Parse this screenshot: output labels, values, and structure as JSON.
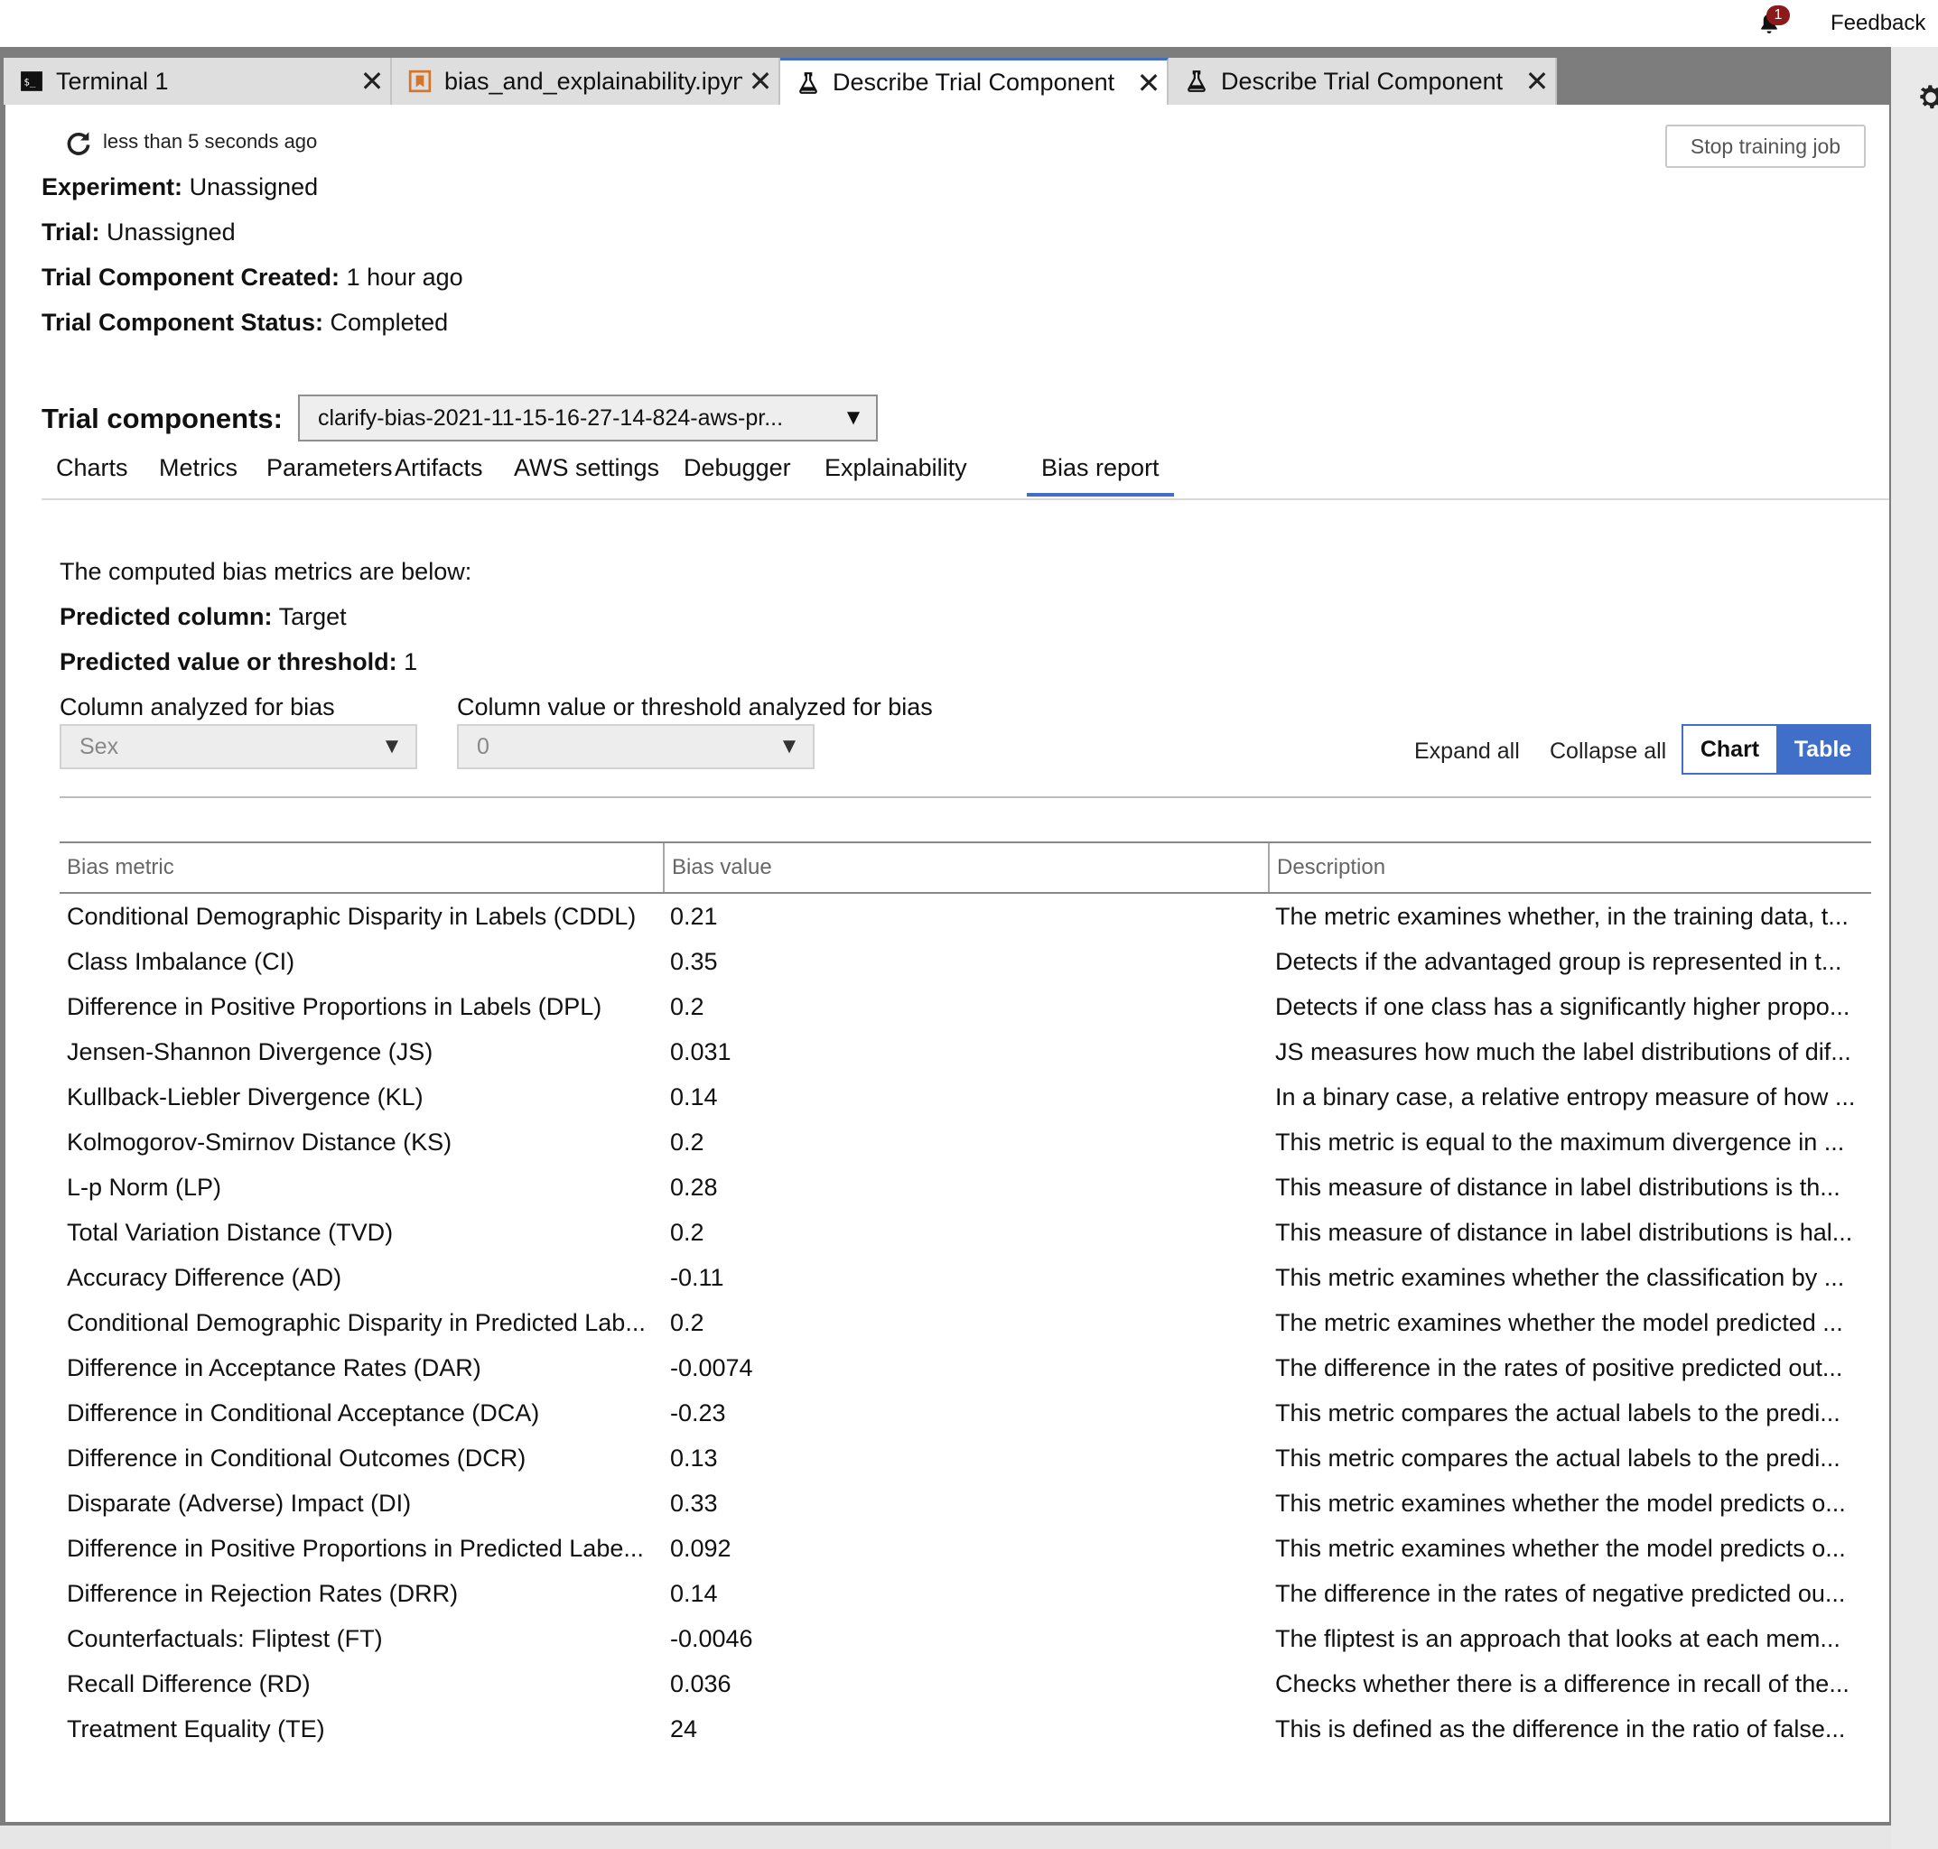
{
  "topbar": {
    "notification_count": "1",
    "feedback_label": "Feedback"
  },
  "tabs": [
    {
      "label": "Terminal 1",
      "icon": "terminal-icon",
      "active": false
    },
    {
      "label": "bias_and_explainability.ipynb",
      "icon": "notebook-icon",
      "active": false
    },
    {
      "label": "Describe Trial Component",
      "icon": "flask-icon",
      "active": true
    },
    {
      "label": "Describe Trial Component",
      "icon": "flask-icon",
      "active": false
    }
  ],
  "header": {
    "last_updated": "less than 5 seconds ago",
    "stop_button": "Stop training job"
  },
  "info": {
    "experiment_label": "Experiment:",
    "experiment_value": "Unassigned",
    "trial_label": "Trial:",
    "trial_value": "Unassigned",
    "created_label": "Trial Component Created:",
    "created_value": "1 hour ago",
    "status_label": "Trial Component Status:",
    "status_value": "Completed"
  },
  "trial_components": {
    "label": "Trial components:",
    "selected": "clarify-bias-2021-11-15-16-27-14-824-aws-pr..."
  },
  "subtabs": [
    "Charts",
    "Metrics",
    "Parameters",
    "Artifacts",
    "AWS settings",
    "Debugger",
    "Explainability",
    "Bias report"
  ],
  "bias_report": {
    "intro": "The computed bias metrics are below:",
    "predicted_column_label": "Predicted column:",
    "predicted_column_value": "Target",
    "predicted_value_label": "Predicted value or threshold:",
    "predicted_value_value": "1",
    "column_label": "Column analyzed for bias",
    "column_value": "Sex",
    "column_value_label": "Column value or threshold analyzed for bias",
    "column_value_value": "0",
    "expand_all": "Expand all",
    "collapse_all": "Collapse all",
    "toggle_chart": "Chart",
    "toggle_table": "Table"
  },
  "table": {
    "headers": [
      "Bias metric",
      "Bias value",
      "Description"
    ],
    "rows": [
      [
        "Conditional Demographic Disparity in Labels (CDDL)",
        "0.21",
        "The metric examines whether, in the training data, t..."
      ],
      [
        "Class Imbalance (CI)",
        "0.35",
        "Detects if the advantaged group is represented in t..."
      ],
      [
        "Difference in Positive Proportions in Labels (DPL)",
        "0.2",
        "Detects if one class has a significantly higher propo..."
      ],
      [
        "Jensen-Shannon Divergence (JS)",
        "0.031",
        "JS measures how much the label distributions of dif..."
      ],
      [
        "Kullback-Liebler Divergence (KL)",
        "0.14",
        "In a binary case, a relative entropy measure of how ..."
      ],
      [
        "Kolmogorov-Smirnov Distance (KS)",
        "0.2",
        "This metric is equal to the maximum divergence in ..."
      ],
      [
        "L-p Norm (LP)",
        "0.28",
        "This measure of distance in label distributions is th..."
      ],
      [
        "Total Variation Distance (TVD)",
        "0.2",
        "This measure of distance in label distributions is hal..."
      ],
      [
        "Accuracy Difference (AD)",
        "-0.11",
        "This metric examines whether the classification by ..."
      ],
      [
        "Conditional Demographic Disparity in Predicted Lab...",
        "0.2",
        "The metric examines whether the model predicted ..."
      ],
      [
        "Difference in Acceptance Rates (DAR)",
        "-0.0074",
        "The difference in the rates of positive predicted out..."
      ],
      [
        "Difference in Conditional Acceptance (DCA)",
        "-0.23",
        "This metric compares the actual labels to the predi..."
      ],
      [
        "Difference in Conditional Outcomes (DCR)",
        "0.13",
        "This metric compares the actual labels to the predi..."
      ],
      [
        "Disparate (Adverse) Impact (DI)",
        "0.33",
        "This metric examines whether the model predicts o..."
      ],
      [
        "Difference in Positive Proportions in Predicted Labe...",
        "0.092",
        "This metric examines whether the model predicts o..."
      ],
      [
        "Difference in Rejection Rates (DRR)",
        "0.14",
        "The difference in the rates of negative predicted ou..."
      ],
      [
        "Counterfactuals: Fliptest (FT)",
        "-0.0046",
        "The fliptest is an approach that looks at each mem..."
      ],
      [
        "Recall Difference (RD)",
        "0.036",
        "Checks whether there is a difference in recall of the..."
      ],
      [
        "Treatment Equality (TE)",
        "24",
        "This is defined as the difference in the ratio of false..."
      ]
    ]
  },
  "colors": {
    "accent": "#3f6fc8",
    "badge": "#8b1a1a"
  }
}
